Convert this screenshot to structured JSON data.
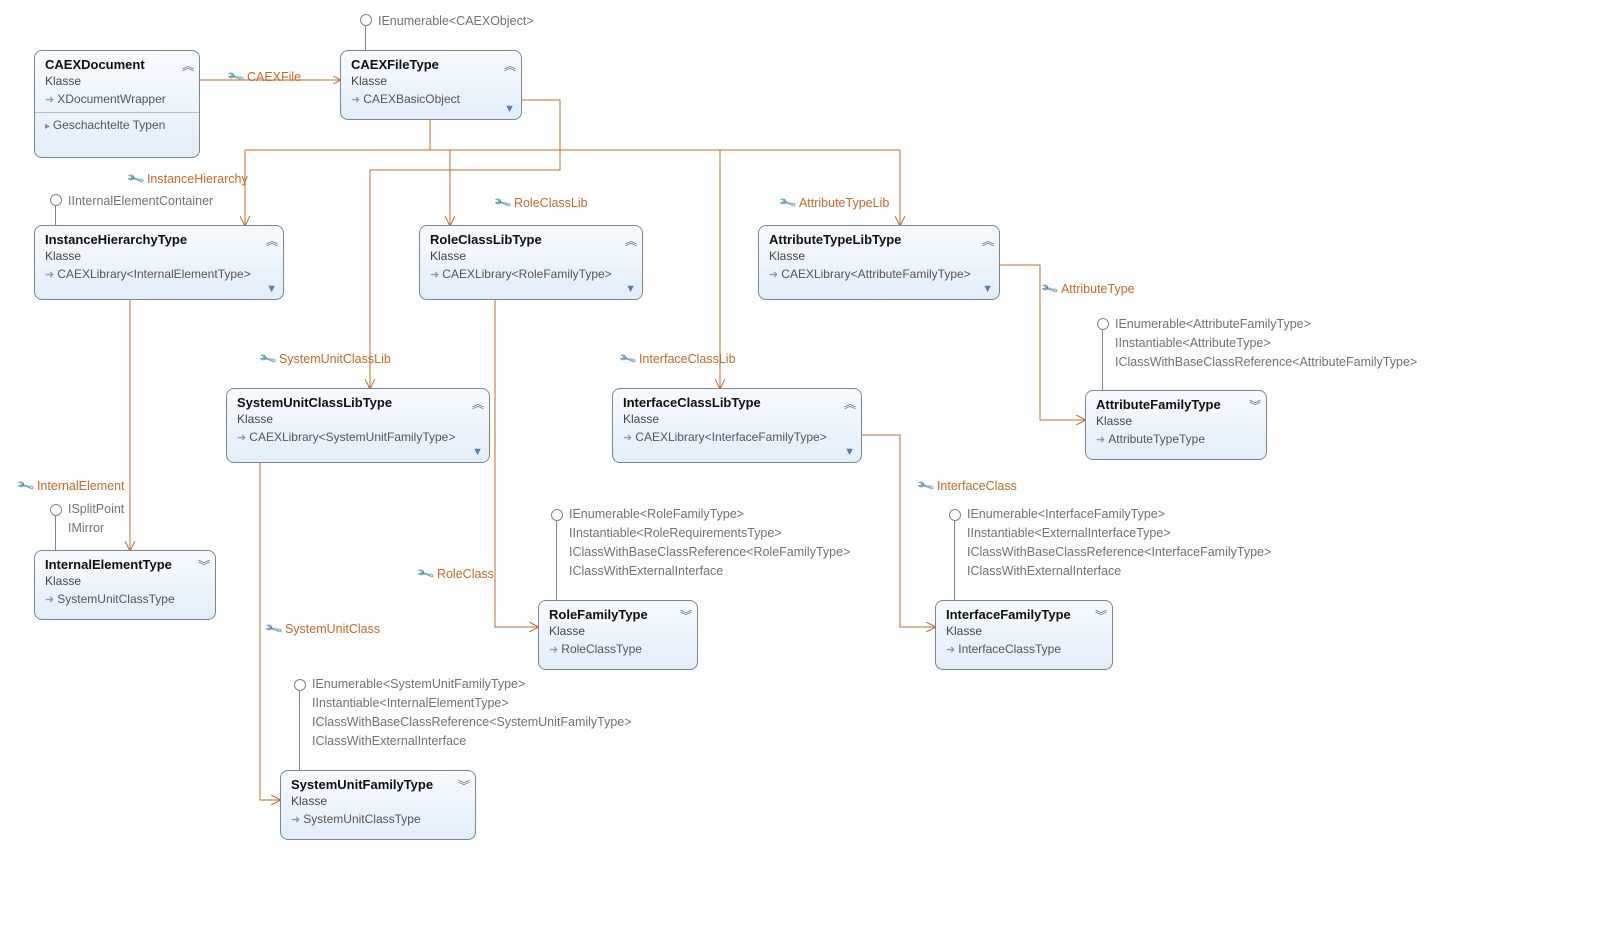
{
  "klasse": "Klasse",
  "nodes": {
    "caexdoc": {
      "title": "CAEXDocument",
      "base": "XDocumentWrapper",
      "section": "Geschachtelte Typen"
    },
    "caexfile": {
      "title": "CAEXFileType",
      "base": "CAEXBasicObject"
    },
    "ih": {
      "title": "InstanceHierarchyType",
      "base": "CAEXLibrary<InternalElementType>"
    },
    "rclib": {
      "title": "RoleClassLibType",
      "base": "CAEXLibrary<RoleFamilyType>"
    },
    "atlib": {
      "title": "AttributeTypeLibType",
      "base": "CAEXLibrary<AttributeFamilyType>"
    },
    "suclib": {
      "title": "SystemUnitClassLibType",
      "base": "CAEXLibrary<SystemUnitFamilyType>"
    },
    "iclib": {
      "title": "InterfaceClassLibType",
      "base": "CAEXLibrary<InterfaceFamilyType>"
    },
    "ie": {
      "title": "InternalElementType",
      "base": "SystemUnitClassType"
    },
    "rft": {
      "title": "RoleFamilyType",
      "base": "RoleClassType"
    },
    "suft": {
      "title": "SystemUnitFamilyType",
      "base": "SystemUnitClassType"
    },
    "ift": {
      "title": "InterfaceFamilyType",
      "base": "InterfaceClassType"
    },
    "aft": {
      "title": "AttributeFamilyType",
      "base": "AttributeTypeType"
    }
  },
  "assoc": {
    "caexfile": "CAEXFile",
    "instancehierarchy": "InstanceHierarchy",
    "roleclasslib": "RoleClassLib",
    "attributetypelib": "AttributeTypeLib",
    "systemunitclasslib": "SystemUnitClassLib",
    "interfaceclasslib": "InterfaceClassLib",
    "internalelement": "InternalElement",
    "roleclass": "RoleClass",
    "systemunitclass": "SystemUnitClass",
    "interfaceclass": "InterfaceClass",
    "attributetype": "AttributeType"
  },
  "impl": {
    "caexfile": "IEnumerable<CAEXObject>",
    "ih": "IInternalElementContainer",
    "ie1": "ISplitPoint",
    "ie2": "IMirror",
    "rft1": "IEnumerable<RoleFamilyType>",
    "rft2": "IInstantiable<RoleRequirementsType>",
    "rft3": "IClassWithBaseClassReference<RoleFamilyType>",
    "rft4": "IClassWithExternalInterface",
    "suft1": "IEnumerable<SystemUnitFamilyType>",
    "suft2": "IInstantiable<InternalElementType>",
    "suft3": "IClassWithBaseClassReference<SystemUnitFamilyType>",
    "suft4": "IClassWithExternalInterface",
    "ift1": "IEnumerable<InterfaceFamilyType>",
    "ift2": "IInstantiable<ExternalInterfaceType>",
    "ift3": "IClassWithBaseClassReference<InterfaceFamilyType>",
    "ift4": "IClassWithExternalInterface",
    "aft1": "IEnumerable<AttributeFamilyType>",
    "aft2": "IInstantiable<AttributeType>",
    "aft3": "IClassWithBaseClassReference<AttributeFamilyType>"
  }
}
